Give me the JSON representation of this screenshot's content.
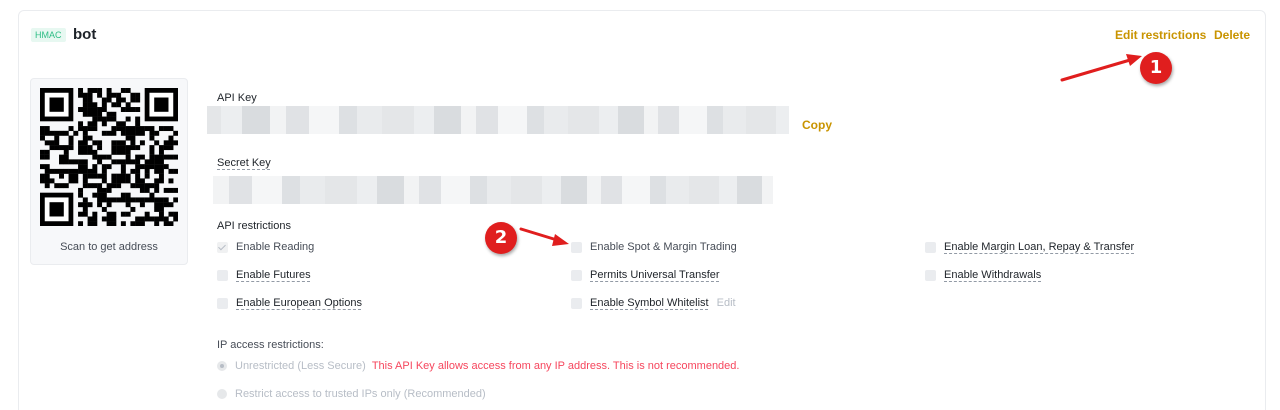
{
  "header": {
    "badge": "HMAC",
    "title": "bot",
    "edit_restrictions": "Edit restrictions",
    "delete": "Delete"
  },
  "qr": {
    "caption": "Scan to get address"
  },
  "api_key": {
    "label": "API Key",
    "copy": "Copy"
  },
  "secret_key": {
    "label": "Secret Key"
  },
  "restrictions": {
    "title": "API restrictions",
    "options": [
      {
        "label": "Enable Reading",
        "checked": true
      },
      {
        "label": "Enable Spot & Margin Trading",
        "checked": false
      },
      {
        "label": "Enable Margin Loan, Repay & Transfer",
        "checked": false
      },
      {
        "label": "Enable Futures",
        "checked": false
      },
      {
        "label": "Permits Universal Transfer",
        "checked": false
      },
      {
        "label": "Enable Withdrawals",
        "checked": false
      },
      {
        "label": "Enable European Options",
        "checked": false
      },
      {
        "label": "Enable Symbol Whitelist",
        "checked": false,
        "action": "Edit"
      }
    ]
  },
  "ip": {
    "title": "IP access restrictions:",
    "unrestricted": "Unrestricted (Less Secure)",
    "warning": "This API Key allows access from any IP address. This is not recommended.",
    "restricted": "Restrict access to trusted IPs only (Recommended)"
  },
  "annotations": {
    "marker1": "1",
    "marker2": "2"
  },
  "colors": {
    "accent": "#c99400",
    "hmac_badge": "#2ebd85",
    "warning": "#f6465d",
    "annotation": "#e01e1e"
  }
}
